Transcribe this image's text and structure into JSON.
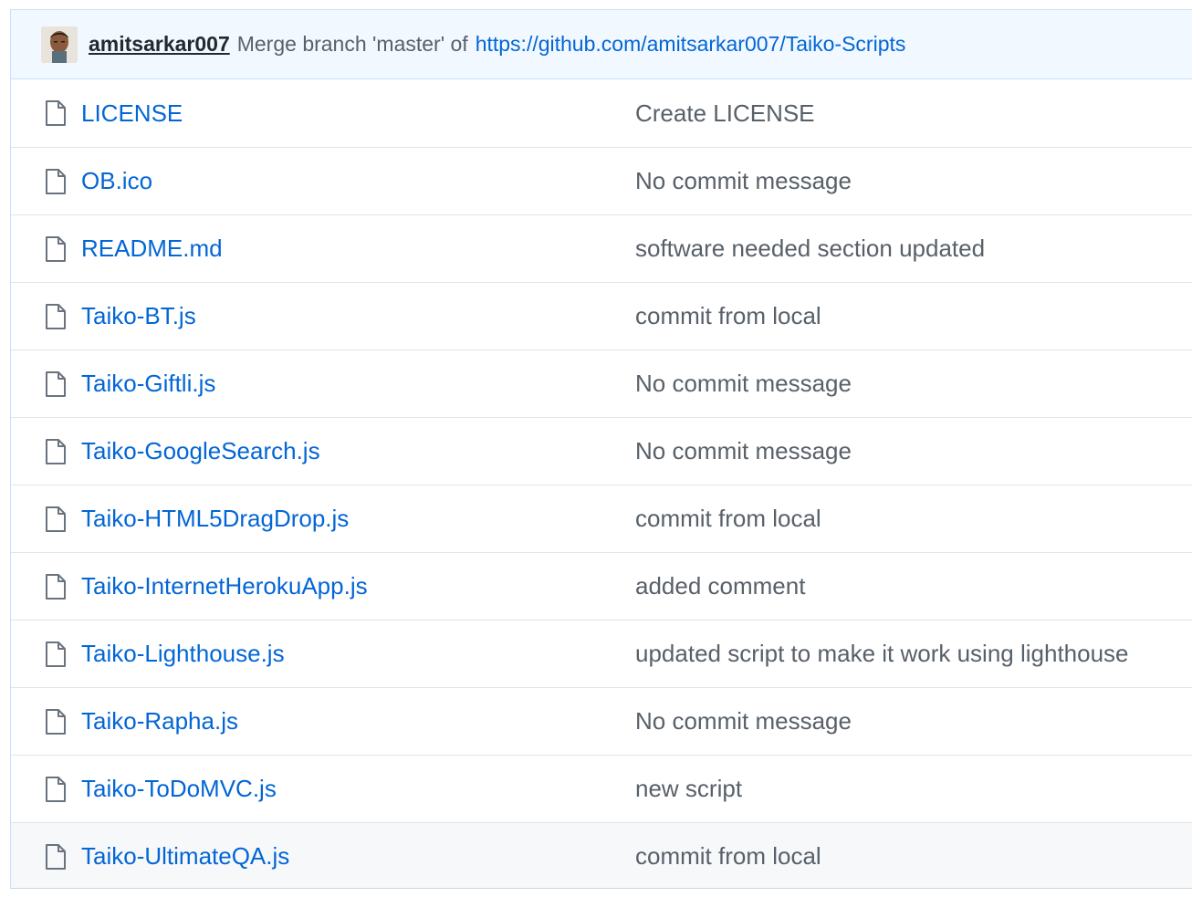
{
  "commit_bar": {
    "author": "amitsarkar007",
    "message": "Merge branch 'master' of",
    "link_text": "https://github.com/amitsarkar007/Taiko-Scripts"
  },
  "files": [
    {
      "name": "LICENSE",
      "message": "Create LICENSE"
    },
    {
      "name": "OB.ico",
      "message": "No commit message"
    },
    {
      "name": "README.md",
      "message": "software needed section updated"
    },
    {
      "name": "Taiko-BT.js",
      "message": "commit from local"
    },
    {
      "name": "Taiko-Giftli.js",
      "message": "No commit message"
    },
    {
      "name": "Taiko-GoogleSearch.js",
      "message": "No commit message"
    },
    {
      "name": "Taiko-HTML5DragDrop.js",
      "message": "commit from local"
    },
    {
      "name": "Taiko-InternetHerokuApp.js",
      "message": "added comment"
    },
    {
      "name": "Taiko-Lighthouse.js",
      "message": "updated script to make it work using lighthouse"
    },
    {
      "name": "Taiko-Rapha.js",
      "message": "No commit message"
    },
    {
      "name": "Taiko-ToDoMVC.js",
      "message": "new script"
    },
    {
      "name": "Taiko-UltimateQA.js",
      "message": "commit from local"
    }
  ],
  "icons": {
    "file": "file-icon",
    "avatar": "avatar"
  },
  "colors": {
    "link": "#0366d6",
    "text_muted": "#586069",
    "commit_bar_bg": "#f1f8ff",
    "hover_row_bg": "#f6f8fa"
  }
}
